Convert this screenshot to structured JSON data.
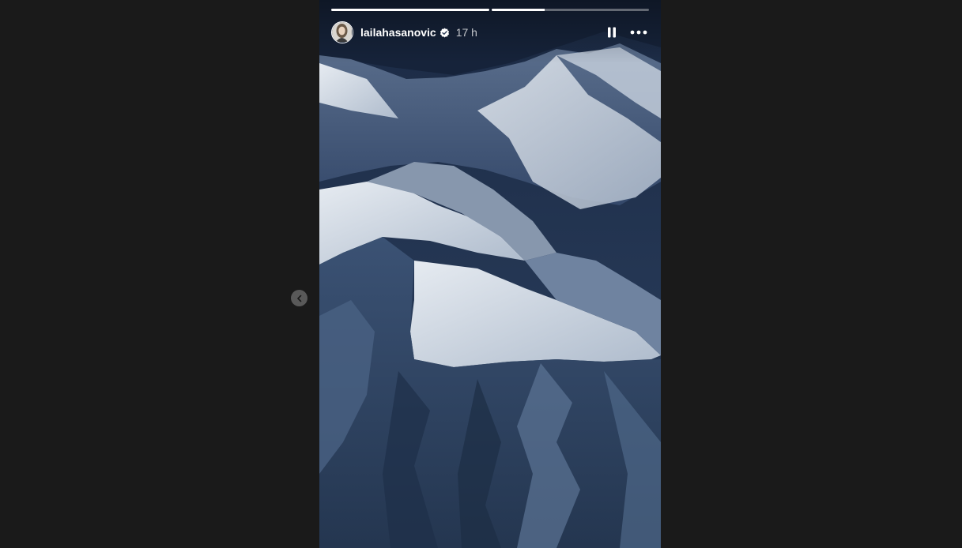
{
  "story": {
    "username": "lailahasanovic",
    "verified": true,
    "timestamp": "17 h",
    "progress": [
      {
        "segment": 1,
        "fill_fraction": 1.0
      },
      {
        "segment": 2,
        "fill_fraction": 0.34
      }
    ],
    "media_subject": "aerial view of snow-covered mountain ridges",
    "icons": {
      "avatar": "profile-avatar",
      "verified": "verified-badge-icon",
      "pause": "pause-icon",
      "more": "more-options-icon",
      "previous": "chevron-left-icon"
    }
  },
  "colors": {
    "page_background": "#1a1a1a",
    "text": "#ffffff",
    "verified_badge": "#ffffff"
  }
}
